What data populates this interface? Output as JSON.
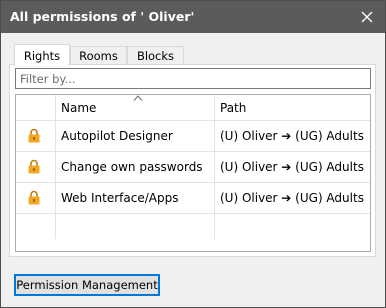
{
  "window": {
    "title": "All permissions of ' Oliver'"
  },
  "tabs": [
    {
      "label": "Rights",
      "active": true
    },
    {
      "label": "Rooms",
      "active": false
    },
    {
      "label": "Blocks",
      "active": false
    }
  ],
  "filter": {
    "placeholder": "Filter by...",
    "value": ""
  },
  "grid": {
    "columns": [
      "",
      "Name",
      "Path"
    ],
    "sort": {
      "column": "Name",
      "direction": "ascending"
    },
    "rows": [
      {
        "icon": "lock-icon",
        "name": "Autopilot Designer",
        "path": "(U) Oliver ➔ (UG) Adults"
      },
      {
        "icon": "lock-icon",
        "name": "Change own passwords",
        "path": "(U) Oliver ➔ (UG) Adults"
      },
      {
        "icon": "lock-icon",
        "name": "Web Interface/Apps",
        "path": "(U) Oliver ➔ (UG) Adults"
      }
    ]
  },
  "buttons": {
    "permission_management": "Permission Management"
  },
  "colors": {
    "titlebar": "#5b5b5b",
    "lock": "#f5a623",
    "focus_border": "#0078d7"
  }
}
